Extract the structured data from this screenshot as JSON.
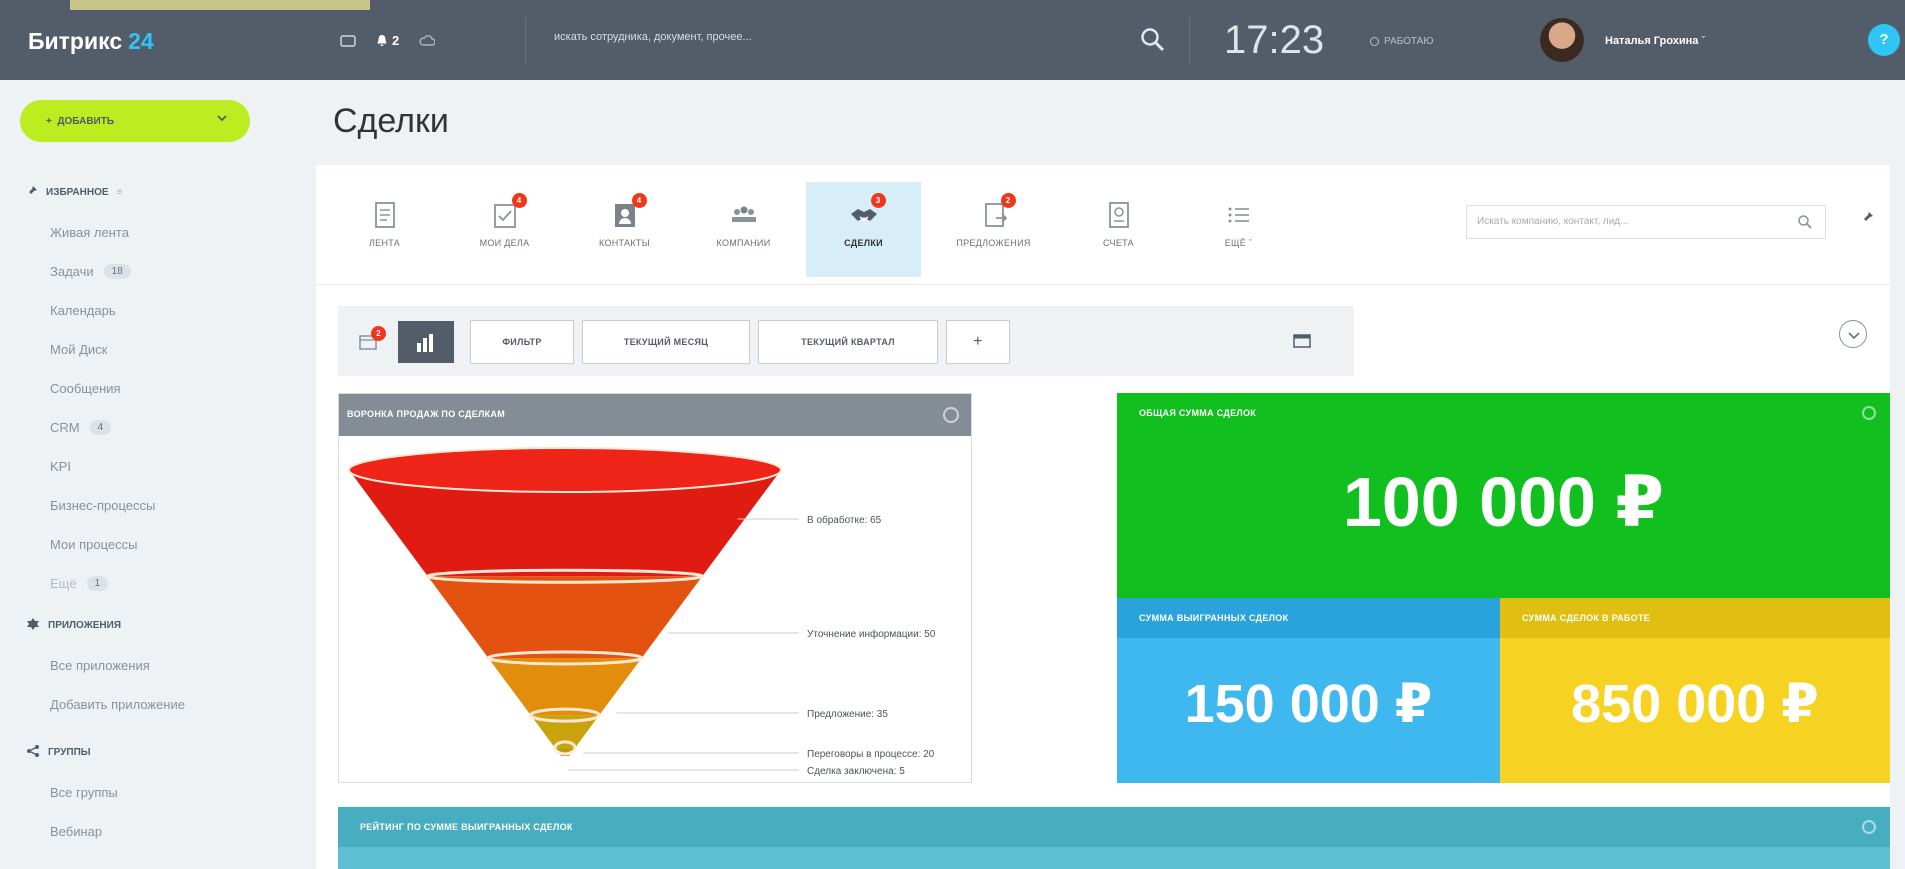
{
  "header": {
    "logo_text": "Битрикс",
    "logo_num": "24",
    "notif_count": "2",
    "search_placeholder": "искать сотрудника, документ, прочее...",
    "clock": "17:23",
    "work_status": "РАБОТАЮ",
    "user_name": "Наталья Грохина",
    "help_label": "?"
  },
  "sidebar": {
    "add_button": "ДОБАВИТЬ",
    "favorites_title": "ИЗБРАННОЕ",
    "favorites": [
      {
        "label": "Живая лента"
      },
      {
        "label": "Задачи",
        "count": "18"
      },
      {
        "label": "Календарь"
      },
      {
        "label": "Мой Диск"
      },
      {
        "label": "Сообщения"
      },
      {
        "label": "CRM",
        "count": "4"
      },
      {
        "label": "KPI"
      },
      {
        "label": "Бизнес-процессы"
      },
      {
        "label": "Мои процессы"
      },
      {
        "label": "Ещё",
        "count": "1"
      }
    ],
    "apps_title": "ПРИЛОЖЕНИЯ",
    "apps": [
      {
        "label": "Все приложения"
      },
      {
        "label": "Добавить приложение"
      }
    ],
    "groups_title": "ГРУППЫ",
    "groups": [
      {
        "label": "Все группы"
      },
      {
        "label": "Вебинар"
      }
    ]
  },
  "page": {
    "title": "Сделки"
  },
  "tabs": [
    {
      "label": "ЛЕНТА",
      "icon": "feed-icon"
    },
    {
      "label": "МОИ ДЕЛА",
      "icon": "my-tasks-icon",
      "badge": "4"
    },
    {
      "label": "КОНТАКТЫ",
      "icon": "contacts-icon",
      "badge": "4"
    },
    {
      "label": "КОМПАНИИ",
      "icon": "companies-icon"
    },
    {
      "label": "СДЕЛКИ",
      "icon": "deals-icon",
      "badge": "3",
      "active": true
    },
    {
      "label": "ПРЕДЛОЖЕНИЯ",
      "icon": "offers-icon",
      "badge": "2"
    },
    {
      "label": "СЧЕТА",
      "icon": "invoices-icon"
    },
    {
      "label": "ЕЩЁ",
      "icon": "more-icon"
    }
  ],
  "crm_search_placeholder": "Искать компанию, контакт, лид...",
  "filters": {
    "grid_badge": "2",
    "filter": "ФИЛЬТР",
    "month": "ТЕКУЩИЙ МЕСЯЦ",
    "quarter": "ТЕКУЩИЙ КВАРТАЛ",
    "add": "+"
  },
  "funnel": {
    "title": "ВОРОНКА ПРОДАЖ ПО СДЕЛКАМ",
    "stages": [
      {
        "label": "В обработке: 65",
        "value": 65,
        "color": "#e01b12"
      },
      {
        "label": "Уточнение информации: 50",
        "value": 50,
        "color": "#e4520f"
      },
      {
        "label": "Предложение: 35",
        "value": 35,
        "color": "#e28d0c"
      },
      {
        "label": "Переговоры в процессе: 20",
        "value": 20,
        "color": "#c9a30b"
      },
      {
        "label": "Сделка заключена: 5",
        "value": 5,
        "color": "#b8a00c"
      }
    ]
  },
  "totals": {
    "all_title": "ОБЩАЯ СУММА СДЕЛОК",
    "all_value": "100 000 ₽",
    "won_title": "СУММА ВЫИГРАННЫХ СДЕЛОК",
    "won_value": "150 000 ₽",
    "work_title": "СУММА СДЕЛОК В РАБОТЕ",
    "work_value": "850 000 ₽"
  },
  "rating": {
    "title": "РЕЙТИНГ ПО СУММЕ ВЫИГРАННЫХ СДЕЛОК"
  },
  "colors": {
    "header": "#535c69",
    "accent_green": "#bbed21",
    "total_green": "#11c01f",
    "won_blue": "#3fb8ef",
    "work_yellow": "#f6d323"
  }
}
